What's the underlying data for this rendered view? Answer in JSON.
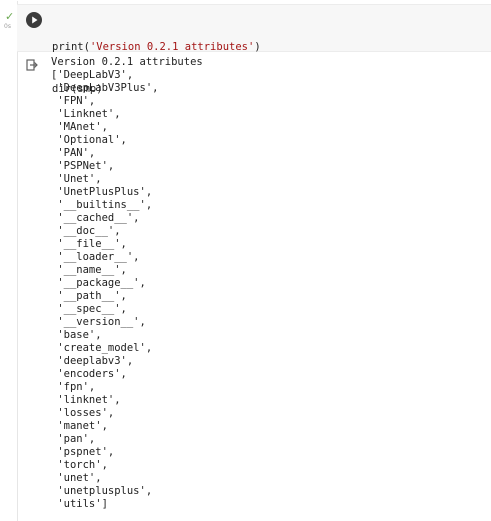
{
  "cell": {
    "status_check": "✓",
    "status_time": "0s",
    "code_line1_fn": "print(",
    "code_line1_str": "'Version 0.2.1 attributes'",
    "code_line1_end": ")",
    "code_line2": "dir(smp)"
  },
  "output": {
    "lines": [
      "Version 0.2.1 attributes",
      "['DeepLabV3',",
      " 'DeepLabV3Plus',",
      " 'FPN',",
      " 'Linknet',",
      " 'MAnet',",
      " 'Optional',",
      " 'PAN',",
      " 'PSPNet',",
      " 'Unet',",
      " 'UnetPlusPlus',",
      " '__builtins__',",
      " '__cached__',",
      " '__doc__',",
      " '__file__',",
      " '__loader__',",
      " '__name__',",
      " '__package__',",
      " '__path__',",
      " '__spec__',",
      " '__version__',",
      " 'base',",
      " 'create_model',",
      " 'deeplabv3',",
      " 'encoders',",
      " 'fpn',",
      " 'linknet',",
      " 'losses',",
      " 'manet',",
      " 'pan',",
      " 'pspnet',",
      " 'torch',",
      " 'unet',",
      " 'unetplusplus',",
      " 'utils']"
    ]
  },
  "icons": {
    "run": "play-icon",
    "output": "output-redirect-icon",
    "status": "check-icon"
  },
  "colors": {
    "run_button": "#3c3c3c",
    "status_check": "#6aa84f",
    "code_bg": "#f7f7f7",
    "string": "#a31515"
  }
}
